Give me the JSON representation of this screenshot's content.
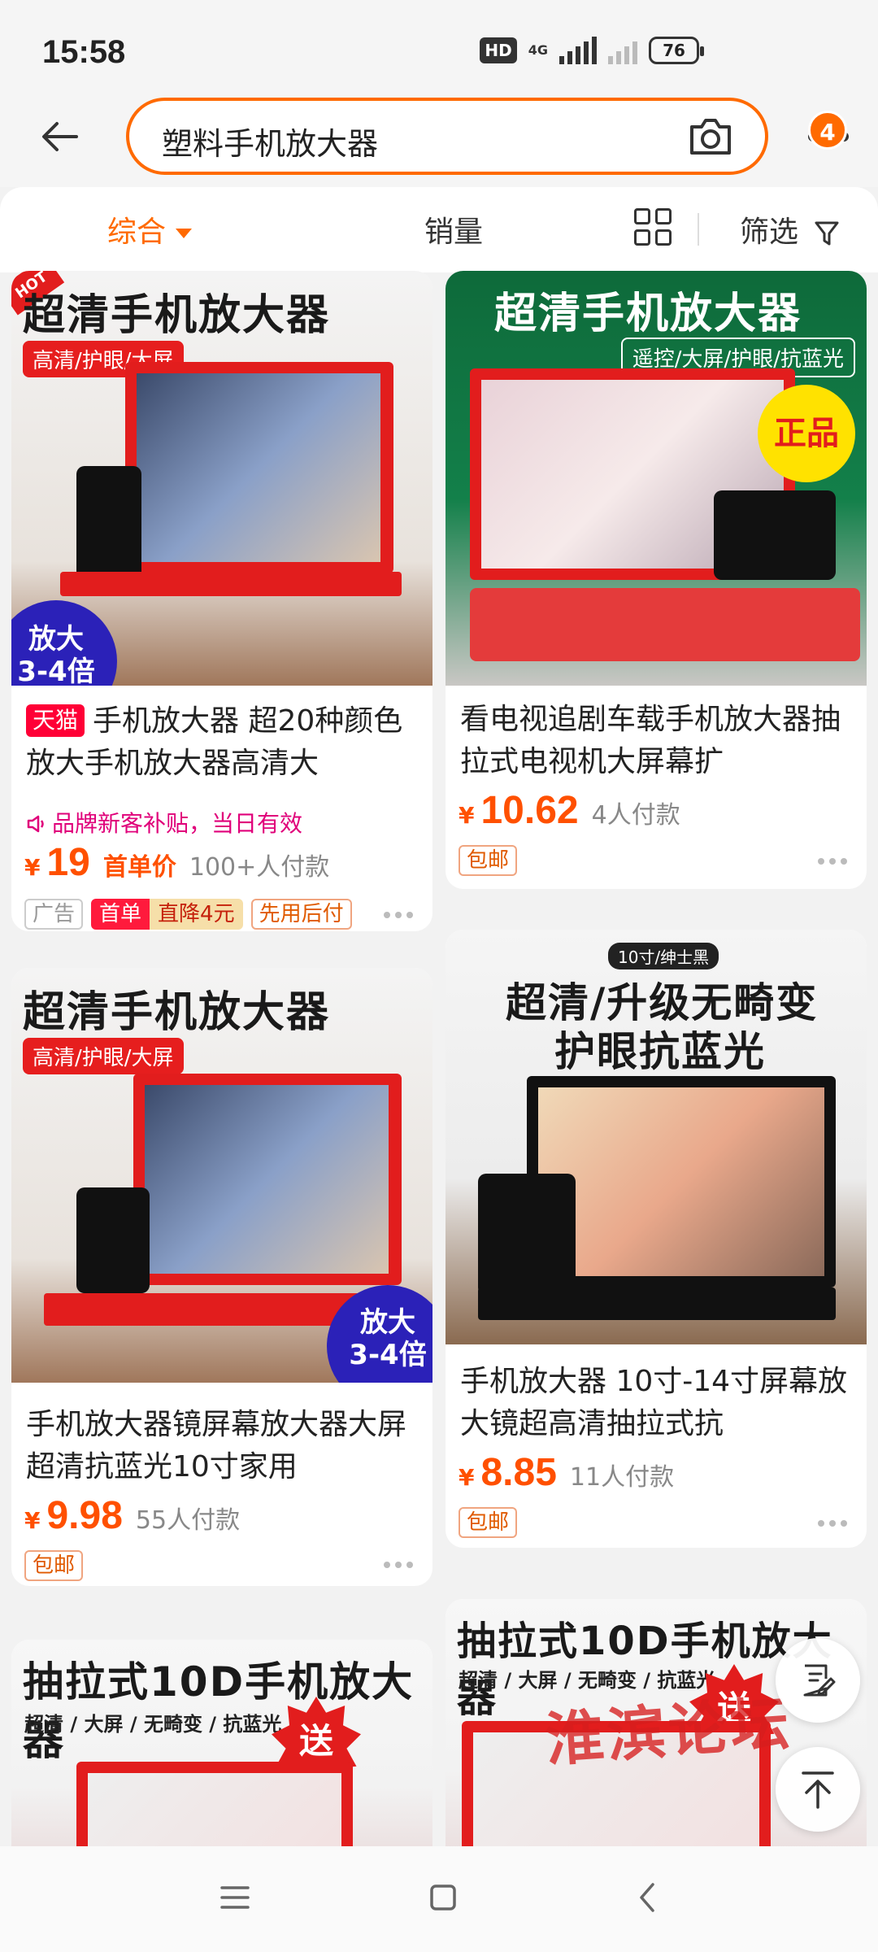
{
  "status_bar": {
    "time": "15:58",
    "hd": "HD",
    "network": "4G",
    "battery": "76"
  },
  "header": {
    "search_query": "塑料手机放大器",
    "message_count": "4"
  },
  "filters": {
    "comprehensive": "综合",
    "sales": "销量",
    "filter": "筛选"
  },
  "products": [
    {
      "img_title": "超清手机放大器",
      "img_sub": "高清/护眼/大屏",
      "img_corner": "HOT",
      "img_promo_line1": "放大",
      "img_promo_line2": "3-4倍",
      "store_badge": "天猫",
      "title": "手机放大器 超20种颜色 放大手机放大器高清大",
      "subsidy": "品牌新客补贴，当日有效",
      "price_yen": "¥",
      "price": "19",
      "price_tag": "首单价",
      "sales": "100+人付款",
      "tags": [
        "广告",
        "首单",
        "直降4元",
        "先用后付"
      ]
    },
    {
      "img_title": "超清手机放大器",
      "img_sub": "遥控/大屏/护眼/抗蓝光",
      "img_badge": "正品",
      "title": "看电视追剧车载手机放大器抽拉式电视机大屏幕扩",
      "price_yen": "¥",
      "price": "10.62",
      "sales": "4人付款",
      "tags": [
        "包邮"
      ]
    },
    {
      "img_title": "超清手机放大器",
      "img_sub": "高清/护眼/大屏",
      "img_promo_line1": "放大",
      "img_promo_line2": "3-4倍",
      "title": "手机放大器镜屏幕放大器大屏超清抗蓝光10寸家用",
      "price_yen": "¥",
      "price": "9.98",
      "sales": "55人付款",
      "tags": [
        "包邮"
      ]
    },
    {
      "img_label": "10寸/绅士黑",
      "img_title_line1": "超清/升级无畸变",
      "img_title_line2": "护眼抗蓝光",
      "title": "手机放大器 10寸-14寸屏幕放大镜超高清抽拉式抗",
      "price_yen": "¥",
      "price": "8.85",
      "sales": "11人付款",
      "tags": [
        "包邮"
      ]
    },
    {
      "img_title": "抽拉式10D手机放大器",
      "img_sub": "超清 / 大屏 / 无畸变 / 抗蓝光",
      "img_gift": "送"
    },
    {
      "img_title": "抽拉式10D手机放大器",
      "img_sub": "超清 / 大屏 / 无畸变 / 抗蓝光",
      "img_gift": "送"
    }
  ],
  "watermark": "淮滨论坛",
  "colors": {
    "accent": "#ff6a00",
    "price": "#ff5000",
    "tmall": "#ff0036"
  }
}
